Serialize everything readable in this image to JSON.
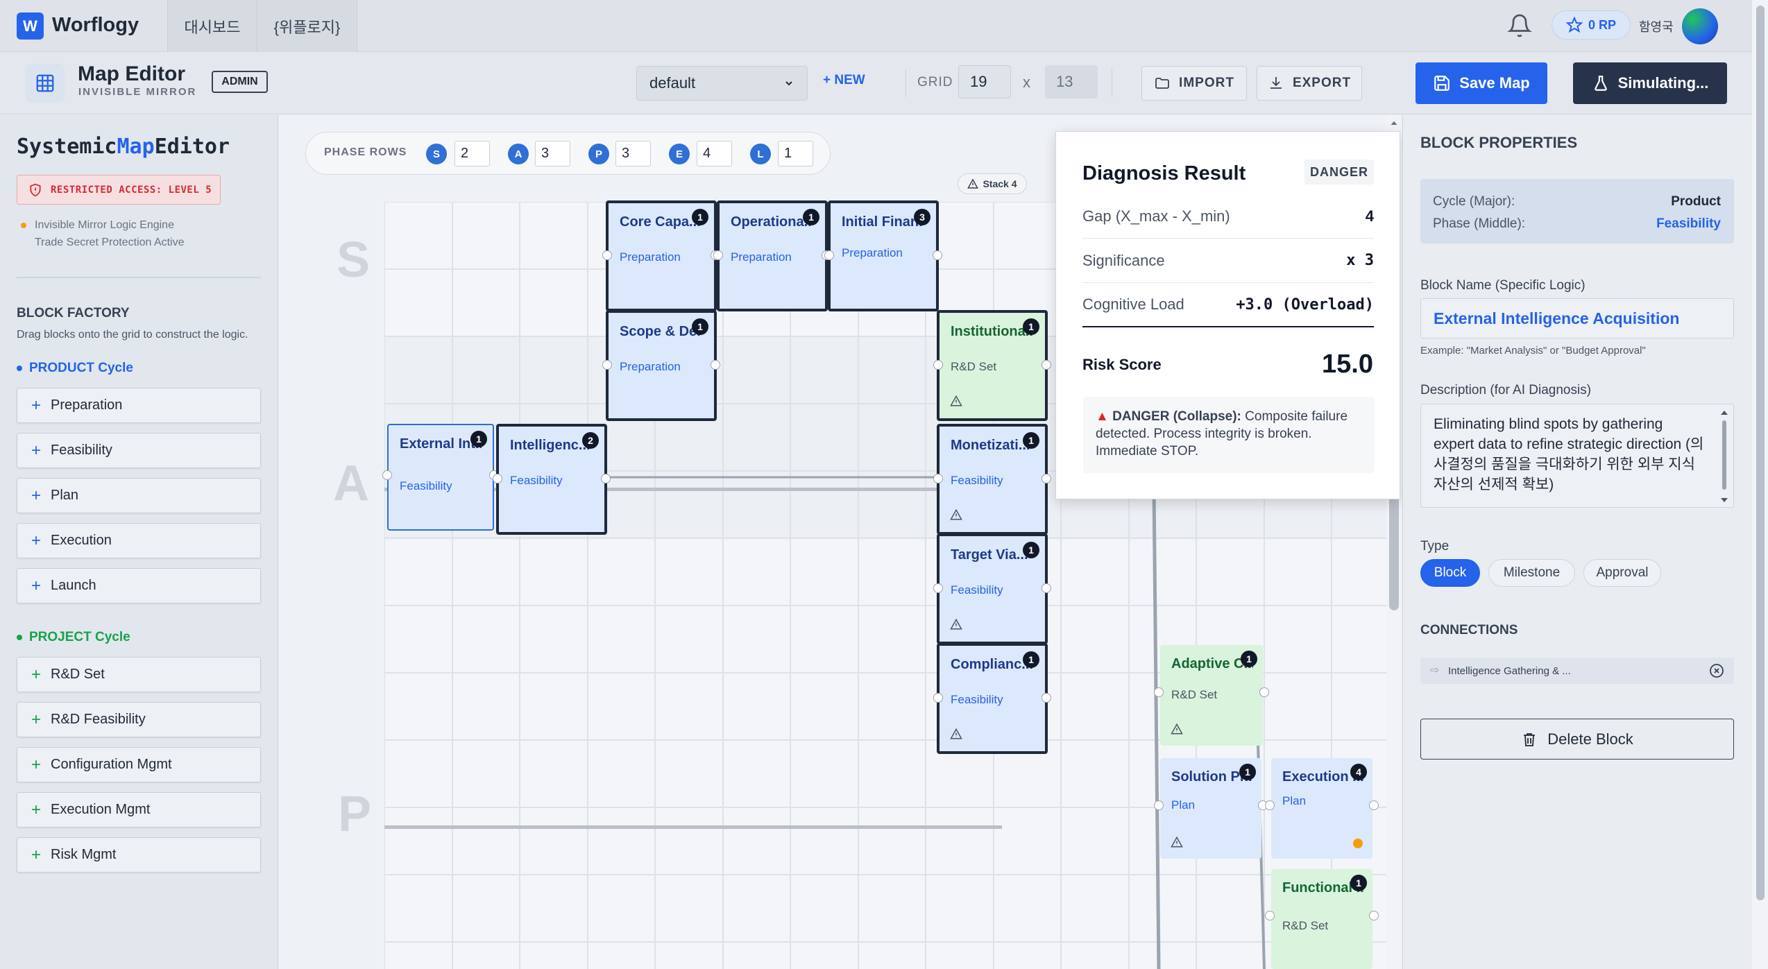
{
  "app": {
    "logo_letter": "W",
    "name": "Worflogy",
    "nav_tabs": [
      "대시보드",
      "{위플로지}"
    ],
    "rp": "0 RP",
    "user_name": "함영국"
  },
  "toolbar": {
    "title": "Map Editor",
    "subtitle": "INVISIBLE MIRROR",
    "admin_badge": "ADMIN",
    "map_select_value": "default",
    "new_label": "+ NEW",
    "grid_label": "GRID",
    "grid_cols": "19",
    "grid_x": "x",
    "grid_rows": "13",
    "import_label": "IMPORT",
    "export_label": "EXPORT",
    "save_label": "Save Map",
    "simulate_label": "Simulating..."
  },
  "sidebar": {
    "title_prefix": "Systemic",
    "title_accent": "Map",
    "title_suffix": "Editor",
    "restricted": "RESTRICTED ACCESS: LEVEL 5",
    "engine_line1": "Invisible Mirror Logic Engine",
    "engine_line2": "Trade Secret Protection Active",
    "factory_title": "BLOCK FACTORY",
    "factory_desc": "Drag blocks onto the grid to construct the logic.",
    "product_cycle": {
      "title": "PRODUCT Cycle",
      "color": "#2563eb",
      "items": [
        "Preparation",
        "Feasibility",
        "Plan",
        "Execution",
        "Launch"
      ]
    },
    "project_cycle": {
      "title": "PROJECT Cycle",
      "color": "#16a34a",
      "items": [
        "R&D Set",
        "R&D Feasibility",
        "Configuration Mgmt",
        "Execution Mgmt",
        "Risk Mgmt"
      ]
    }
  },
  "phase_rows": {
    "label": "PHASE ROWS",
    "rows": [
      {
        "letter": "S",
        "count": "2"
      },
      {
        "letter": "A",
        "count": "3"
      },
      {
        "letter": "P",
        "count": "3"
      },
      {
        "letter": "E",
        "count": "4"
      },
      {
        "letter": "L",
        "count": "1"
      }
    ]
  },
  "canvas": {
    "row_letters": [
      "S",
      "A",
      "P"
    ],
    "stack_label": "Stack 4",
    "blocks": [
      {
        "name": "Core Capa...",
        "phase": "Preparation",
        "badge": "1",
        "style": "blue"
      },
      {
        "name": "Operationa...",
        "phase": "Preparation",
        "badge": "1",
        "style": "blue"
      },
      {
        "name": "Initial Finan...",
        "phase": "Preparation",
        "badge": "3",
        "style": "blue"
      },
      {
        "name": "Scope & De...",
        "phase": "Preparation",
        "badge": "1",
        "style": "blue"
      },
      {
        "name": "Institutiona...",
        "phase": "R&D Set",
        "badge": "1",
        "style": "green"
      },
      {
        "name": "External Int...",
        "phase": "Feasibility",
        "badge": "1",
        "style": "selected"
      },
      {
        "name": "Intelligenc...",
        "phase": "Feasibility",
        "badge": "2",
        "style": "blue"
      },
      {
        "name": "Monetizati...",
        "phase": "Feasibility",
        "badge": "1",
        "style": "blue"
      },
      {
        "name": "Target Via...",
        "phase": "Feasibility",
        "badge": "1",
        "style": "blue"
      },
      {
        "name": "Complianc...",
        "phase": "Feasibility",
        "badge": "1",
        "style": "blue"
      },
      {
        "name": "Adaptive C...",
        "phase": "R&D Set",
        "badge": "1",
        "style": "green-plain"
      },
      {
        "name": "Solution Pr...",
        "phase": "Plan",
        "badge": "1",
        "style": "blue-plain"
      },
      {
        "name": "Execution ...",
        "phase": "Plan",
        "badge": "4",
        "style": "blue-plain"
      },
      {
        "name": "Functional ...",
        "phase": "R&D Set",
        "badge": "1",
        "style": "green-plain"
      }
    ]
  },
  "diagnosis": {
    "title": "Diagnosis Result",
    "badge": "DANGER",
    "rows": [
      {
        "label": "Gap (X_max - X_min)",
        "value": "4"
      },
      {
        "label": "Significance",
        "value": "x 3"
      },
      {
        "label": "Cognitive Load",
        "value": "+3.0 (Overload)"
      }
    ],
    "risk_label": "Risk Score",
    "risk_value": "15.0",
    "message_bold": "DANGER (Collapse):",
    "message_rest": " Composite failure detected. Process integrity is broken. Immediate STOP."
  },
  "properties": {
    "title": "BLOCK PROPERTIES",
    "cycle_label": "Cycle (Major):",
    "cycle_value": "Product",
    "phase_label": "Phase (Middle):",
    "phase_value": "Feasibility",
    "block_name_label": "Block Name (Specific Logic)",
    "block_name": "External Intelligence Acquisition",
    "block_name_hint": "Example: \"Market Analysis\" or \"Budget Approval\"",
    "description_label": "Description (for AI Diagnosis)",
    "description": "Eliminating blind spots by gathering expert data to refine strategic direction (의사결정의 품질을 극대화하기 위한 외부 지식 자산의 선제적 확보)",
    "type_label": "Type",
    "types": [
      "Block",
      "Milestone",
      "Approval"
    ],
    "type_selected": "Block",
    "connections_title": "CONNECTIONS",
    "connection": "Intelligence Gathering & ...",
    "delete_label": "Delete Block"
  }
}
